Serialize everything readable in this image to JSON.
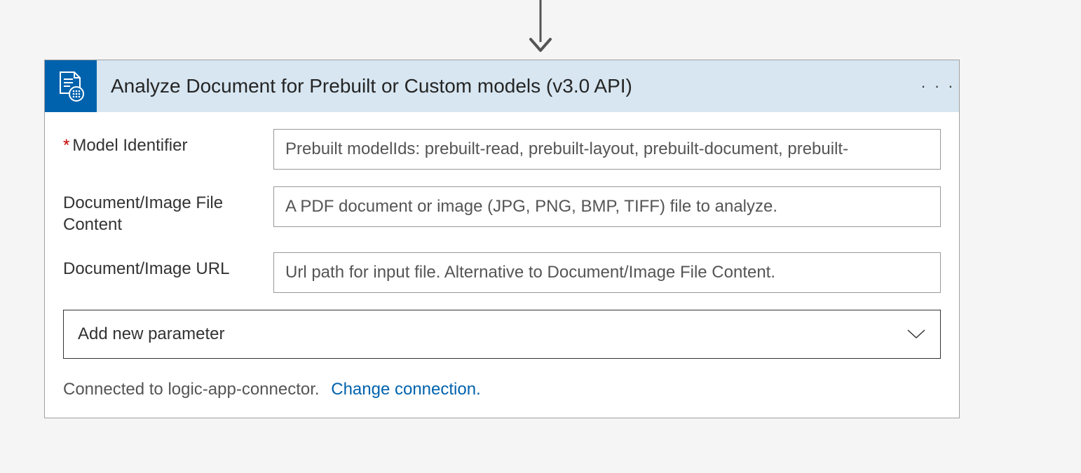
{
  "header": {
    "title": "Analyze Document for Prebuilt or Custom models (v3.0 API)"
  },
  "fields": {
    "model_identifier": {
      "label": "Model Identifier",
      "required": true,
      "placeholder": "Prebuilt modelIds: prebuilt-read, prebuilt-layout, prebuilt-document, prebuilt-"
    },
    "file_content": {
      "label": "Document/Image File Content",
      "required": false,
      "placeholder": "A PDF document or image (JPG, PNG, BMP, TIFF) file to analyze."
    },
    "image_url": {
      "label": "Document/Image URL",
      "required": false,
      "placeholder": "Url path for input file. Alternative to Document/Image File Content."
    }
  },
  "add_param": {
    "label": "Add new parameter"
  },
  "footer": {
    "connected_text": "Connected to logic-app-connector.",
    "change_link": "Change connection."
  },
  "colors": {
    "header_bg": "#d7e6f1",
    "icon_bg": "#0062ad",
    "link": "#0062ad",
    "required": "#c40000"
  }
}
